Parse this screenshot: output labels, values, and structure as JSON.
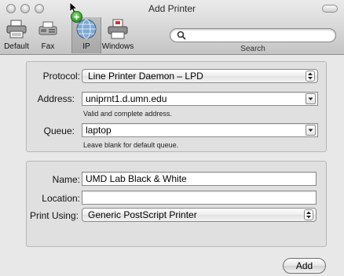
{
  "window": {
    "title": "Add Printer"
  },
  "toolbar": {
    "items": [
      {
        "label": "Default",
        "icon": "printer-icon"
      },
      {
        "label": "Fax",
        "icon": "fax-icon"
      },
      {
        "label": "IP",
        "icon": "globe-icon"
      },
      {
        "label": "Windows",
        "icon": "windows-printer-icon"
      }
    ],
    "selected": "IP",
    "search": {
      "label": "Search",
      "value": ""
    }
  },
  "connection": {
    "protocol_label": "Protocol:",
    "protocol_value": "Line Printer Daemon – LPD",
    "address_label": "Address:",
    "address_value": "uniprnt1.d.umn.edu",
    "address_hint": "Valid and complete address.",
    "queue_label": "Queue:",
    "queue_value": "laptop",
    "queue_hint": "Leave blank for default queue."
  },
  "printer": {
    "name_label": "Name:",
    "name_value": "UMD Lab Black & White",
    "location_label": "Location:",
    "location_value": "",
    "print_using_label": "Print Using:",
    "print_using_value": "Generic PostScript Printer"
  },
  "actions": {
    "add_label": "Add"
  },
  "colors": {
    "titlebar": "#d6d6d6",
    "window_bg": "#e8e8e8",
    "panel_bg": "#e0e0e0",
    "badge_green": "#2f9a2a"
  }
}
